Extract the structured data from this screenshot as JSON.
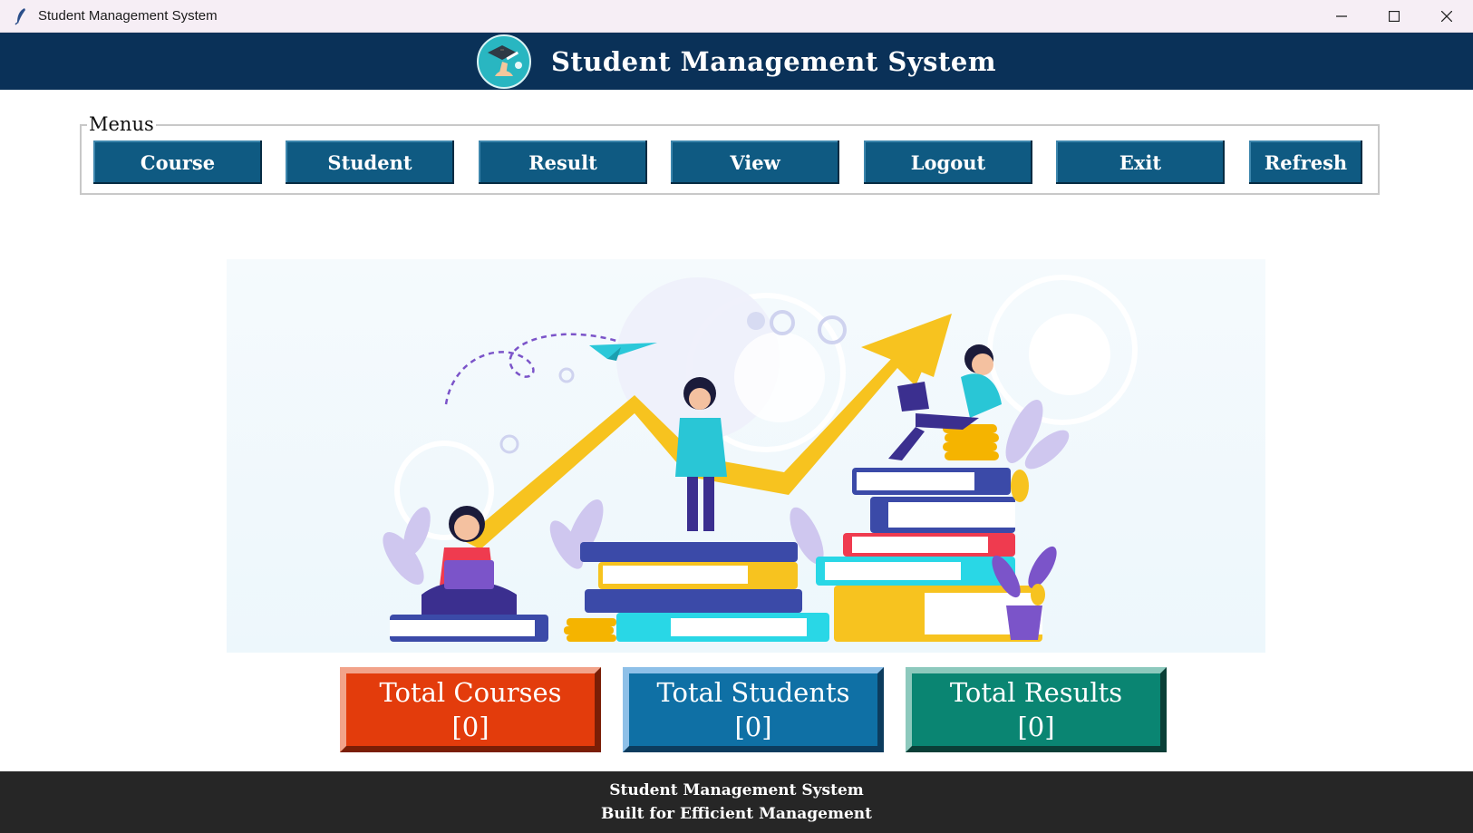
{
  "window": {
    "title": "Student Management System",
    "icons": {
      "app": "feather-icon",
      "minimize": "minimize-icon",
      "maximize": "maximize-icon",
      "close": "close-icon"
    }
  },
  "header": {
    "title": "Student Management System",
    "logo_icon": "graduation-logo-icon",
    "background": "#0a3158"
  },
  "menus": {
    "label": "Menus",
    "buttons": [
      {
        "label": "Course"
      },
      {
        "label": "Student"
      },
      {
        "label": "Result"
      },
      {
        "label": "View"
      },
      {
        "label": "Logout"
      },
      {
        "label": "Exit"
      },
      {
        "label": "Refresh"
      }
    ],
    "button_color": "#0f5a82"
  },
  "hero": {
    "icon": "education-growth-illustration"
  },
  "stats": [
    {
      "label": "Total Courses",
      "value": "[0]",
      "color": "#e33c0c"
    },
    {
      "label": "Total Students",
      "value": "[0]",
      "color": "#0f70a5"
    },
    {
      "label": "Total Results",
      "value": "[0]",
      "color": "#0a8572"
    }
  ],
  "footer": {
    "line1": "Student Management System",
    "line2": "Built for Efficient Management"
  }
}
